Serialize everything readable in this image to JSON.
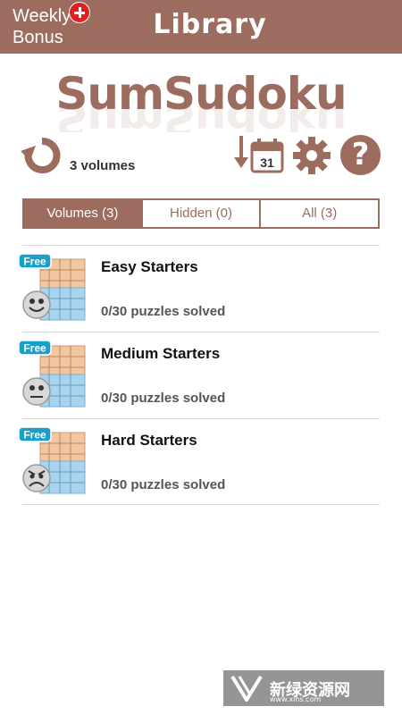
{
  "header": {
    "weekly_bonus_label": "Weekly Bonus",
    "title": "Library"
  },
  "logo": {
    "text": "SumSudoku"
  },
  "toolbar": {
    "volume_count": "3 volumes",
    "calendar_day": "31"
  },
  "tabs": [
    {
      "label": "Volumes (3)",
      "active": true
    },
    {
      "label": "Hidden (0)",
      "active": false
    },
    {
      "label": "All (3)",
      "active": false
    }
  ],
  "volumes": [
    {
      "badge": "Free",
      "title": "Easy Starters",
      "progress": "0/30 puzzles solved",
      "face": "happy"
    },
    {
      "badge": "Free",
      "title": "Medium Starters",
      "progress": "0/30 puzzles solved",
      "face": "neutral"
    },
    {
      "badge": "Free",
      "title": "Hard Starters",
      "progress": "0/30 puzzles solved",
      "face": "angry"
    }
  ],
  "watermark": {
    "text": "新绿资源网",
    "sub": "www.xlhs.com"
  },
  "colors": {
    "brand": "#9c6d5f",
    "badge_red": "#e02020",
    "free_badge": "#1aa0c8"
  },
  "icons": [
    "refresh-icon",
    "calendar-download-icon",
    "gear-icon",
    "help-icon"
  ]
}
